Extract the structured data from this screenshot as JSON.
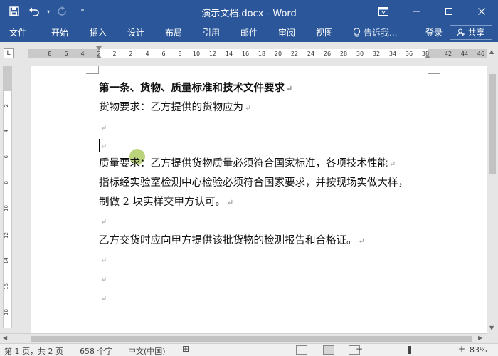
{
  "titlebar": {
    "title": "演示文档.docx - Word",
    "qat": {
      "save_icon": "save-icon",
      "undo_icon": "undo-icon",
      "redo_icon": "redo-icon",
      "customize_icon": "customize-qat-icon"
    },
    "controls": {
      "ribbon_display_icon": "ribbon-display-options-icon",
      "minimize_icon": "minimize-icon",
      "maximize_icon": "maximize-icon",
      "close_icon": "close-icon"
    },
    "bg_color": "#2b579a"
  },
  "ribbon": {
    "tabs": [
      "文件",
      "开始",
      "插入",
      "设计",
      "布局",
      "引用",
      "邮件",
      "审阅",
      "视图"
    ],
    "tell_me": "告诉我...",
    "sign_in": "登录",
    "share": "共享"
  },
  "ruler": {
    "numbers": [
      "8",
      "6",
      "4",
      "2",
      "2",
      "2",
      "4",
      "6",
      "8",
      "10",
      "12",
      "14",
      "16",
      "18",
      "20",
      "22",
      "24",
      "26",
      "28",
      "30",
      "32",
      "34",
      "36",
      "38",
      "42",
      "44",
      "46"
    ],
    "vertical_numbers": [
      "2",
      "4",
      "6",
      "8",
      "10",
      "12",
      "14",
      "16",
      "18"
    ]
  },
  "document": {
    "paragraphs": [
      {
        "text": "第一条、货物、质量标准和技术文件要求",
        "bold": true
      },
      {
        "text": "货物要求：乙方提供的货物应为",
        "bold": false
      },
      {
        "text": "",
        "bold": false
      },
      {
        "text": "",
        "bold": false
      },
      {
        "text": "质量要求：乙方提供货物质量必须符合国家标准，各项技术性能",
        "bold": false
      },
      {
        "text": "指标经实验室检测中心检验必须符合国家要求，并按现场实做大样，",
        "bold": false
      },
      {
        "text": "制做 2 块实样交甲方认可。",
        "bold": false
      },
      {
        "text": "",
        "bold": false
      },
      {
        "text": "乙方交货时应向甲方提供该批货物的检测报告和合格证。",
        "bold": false
      },
      {
        "text": "",
        "bold": false
      },
      {
        "text": "",
        "bold": false
      },
      {
        "text": "",
        "bold": false
      }
    ],
    "paragraph_mark": "↵"
  },
  "statusbar": {
    "page_info": "第 1 页，共 2 页",
    "word_count": "658 个字",
    "language": "中文(中国)",
    "zoom": "83%",
    "zoom_minus": "−",
    "zoom_plus": "+"
  }
}
